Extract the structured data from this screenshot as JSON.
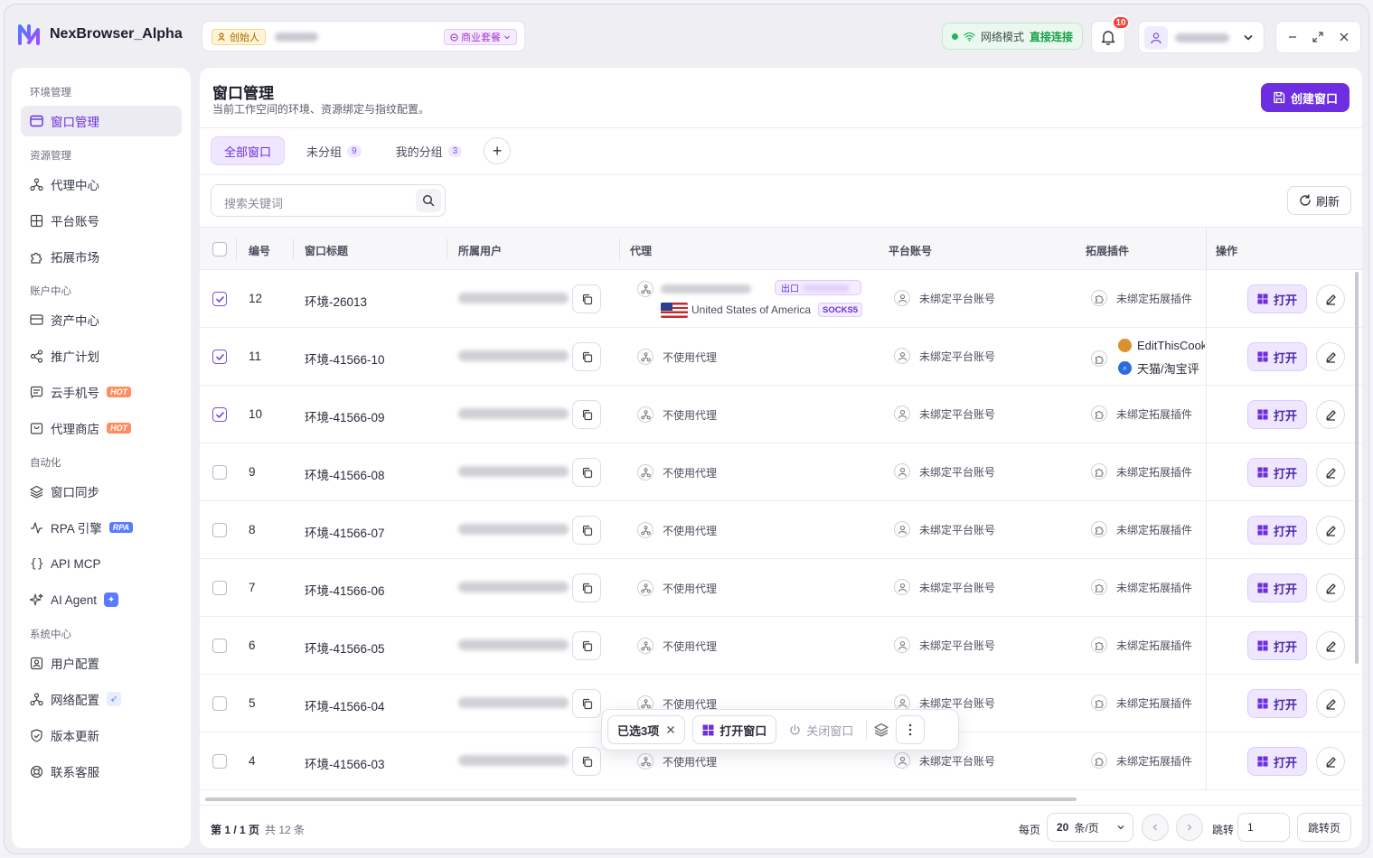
{
  "app": {
    "name": "NexBrowser_Alpha"
  },
  "header": {
    "founder_label": "创始人",
    "plan_label": "商业套餐",
    "net_label": "网络模式",
    "net_value": "直接连接",
    "notif_count": "10"
  },
  "sidebar": {
    "groups": [
      {
        "label": "环境管理",
        "items": [
          {
            "label": "窗口管理",
            "icon": "window-icon",
            "active": true
          }
        ]
      },
      {
        "label": "资源管理",
        "items": [
          {
            "label": "代理中心",
            "icon": "proxy-icon"
          },
          {
            "label": "平台账号",
            "icon": "grid-icon"
          },
          {
            "label": "拓展市场",
            "icon": "puzzle-icon"
          }
        ]
      },
      {
        "label": "账户中心",
        "items": [
          {
            "label": "资产中心",
            "icon": "wallet-icon"
          },
          {
            "label": "推广计划",
            "icon": "share-icon"
          },
          {
            "label": "云手机号",
            "icon": "message-icon",
            "badge": "HOT"
          },
          {
            "label": "代理商店",
            "icon": "store-icon",
            "badge": "HOT"
          }
        ]
      },
      {
        "label": "自动化",
        "items": [
          {
            "label": "窗口同步",
            "icon": "layers-icon"
          },
          {
            "label": "RPA 引擎",
            "icon": "pulse-icon",
            "badge": "RPA"
          },
          {
            "label": "API MCP",
            "icon": "braces-icon"
          },
          {
            "label": "AI Agent",
            "icon": "sparkle-icon"
          }
        ]
      },
      {
        "label": "系统中心",
        "items": [
          {
            "label": "用户配置",
            "icon": "user-config-icon"
          },
          {
            "label": "网络配置",
            "icon": "network-icon"
          },
          {
            "label": "版本更新",
            "icon": "shield-icon"
          },
          {
            "label": "联系客服",
            "icon": "lifebuoy-icon"
          }
        ]
      }
    ]
  },
  "page": {
    "title": "窗口管理",
    "subtitle": "当前工作空间的环境、资源绑定与指纹配置。",
    "create_label": "创建窗口",
    "tabs": [
      {
        "label": "全部窗口",
        "count": ""
      },
      {
        "label": "未分组",
        "count": "9"
      },
      {
        "label": "我的分组",
        "count": "3"
      }
    ],
    "search_placeholder": "搜索关键词",
    "refresh_label": "刷新"
  },
  "table": {
    "columns": [
      "编号",
      "窗口标题",
      "所属用户",
      "代理",
      "平台账号",
      "拓展插件",
      "操作"
    ],
    "rows": [
      {
        "checked": true,
        "num": "12",
        "title": "环境-26013",
        "proxy": "",
        "platform": "未绑定平台账号",
        "ext": "未绑定拓展插件"
      },
      {
        "checked": true,
        "num": "11",
        "title": "环境-41566-10",
        "proxy": "不使用代理",
        "platform": "未绑定平台账号",
        "ext": ""
      },
      {
        "checked": true,
        "num": "10",
        "title": "环境-41566-09",
        "proxy": "不使用代理",
        "platform": "未绑定平台账号",
        "ext": "未绑定拓展插件"
      },
      {
        "checked": false,
        "num": "9",
        "title": "环境-41566-08",
        "proxy": "不使用代理",
        "platform": "未绑定平台账号",
        "ext": "未绑定拓展插件"
      },
      {
        "checked": false,
        "num": "8",
        "title": "环境-41566-07",
        "proxy": "不使用代理",
        "platform": "未绑定平台账号",
        "ext": "未绑定拓展插件"
      },
      {
        "checked": false,
        "num": "7",
        "title": "环境-41566-06",
        "proxy": "不使用代理",
        "platform": "未绑定平台账号",
        "ext": "未绑定拓展插件"
      },
      {
        "checked": false,
        "num": "6",
        "title": "环境-41566-05",
        "proxy": "不使用代理",
        "platform": "未绑定平台账号",
        "ext": "未绑定拓展插件"
      },
      {
        "checked": false,
        "num": "5",
        "title": "环境-41566-04",
        "proxy": "不使用代理",
        "platform": "未绑定平台账号",
        "ext": "未绑定拓展插件"
      },
      {
        "checked": false,
        "num": "4",
        "title": "环境-41566-03",
        "proxy": "不使用代理",
        "platform": "未绑定平台账号",
        "ext": "未绑定拓展插件"
      }
    ],
    "row12_exit_label": "出口",
    "row12_country": "United States of America",
    "row12_proto": "SOCKS5",
    "row11_ext": [
      "EditThisCookie",
      "天猫/淘宝评"
    ],
    "open_label": "打开"
  },
  "floatbar": {
    "selected": "已选3项",
    "open": "打开窗口",
    "close": "关闭窗口"
  },
  "footer": {
    "page_label": "第 1 / 1 页",
    "total_label": "共 12 条",
    "per_page_label": "每页",
    "per_page_value": "20",
    "per_page_unit": "条/页",
    "jump_label": "跳转",
    "jump_value": "1",
    "jump_btn": "跳转页"
  }
}
